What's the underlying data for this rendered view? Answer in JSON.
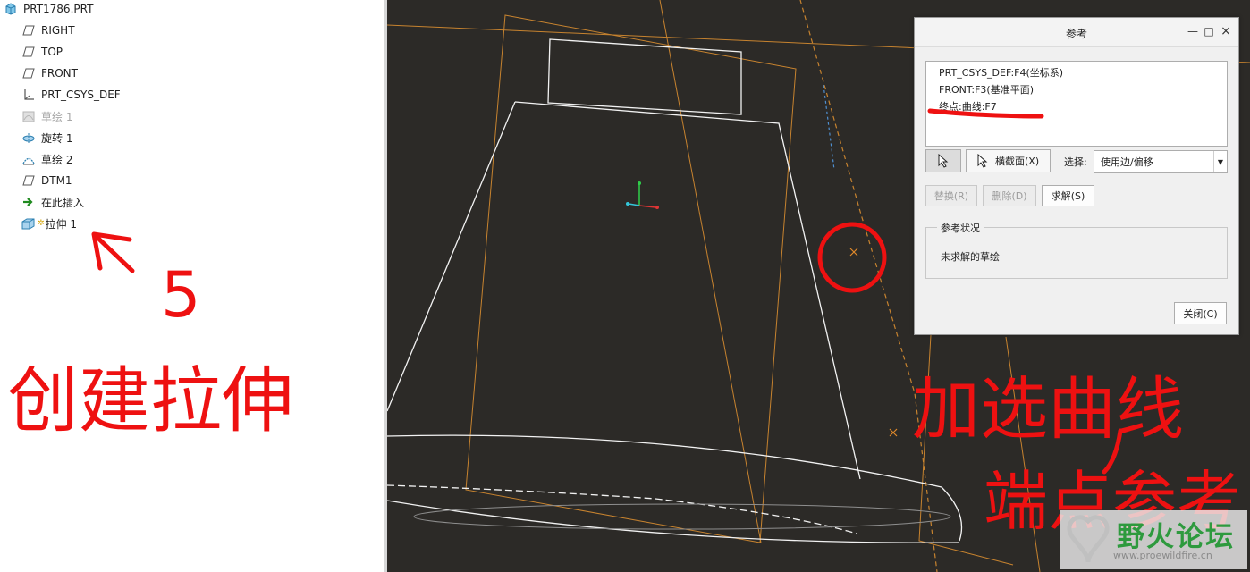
{
  "model_tree": {
    "root": "PRT1786.PRT",
    "items": [
      {
        "label": "RIGHT",
        "icon": "datum-plane-icon",
        "disabled": false
      },
      {
        "label": "TOP",
        "icon": "datum-plane-icon",
        "disabled": false
      },
      {
        "label": "FRONT",
        "icon": "datum-plane-icon",
        "disabled": false
      },
      {
        "label": "PRT_CSYS_DEF",
        "icon": "csys-icon",
        "disabled": false
      },
      {
        "label": "草绘 1",
        "icon": "sketch-icon",
        "disabled": true
      },
      {
        "label": "旋转 1",
        "icon": "revolve-icon",
        "disabled": false
      },
      {
        "label": "草绘 2",
        "icon": "sketch-icon",
        "disabled": false
      },
      {
        "label": "DTM1",
        "icon": "datum-plane-icon",
        "disabled": false
      },
      {
        "label": "在此插入",
        "icon": "insert-here-arrow-icon",
        "disabled": false
      },
      {
        "label": "拉伸 1",
        "icon": "extrude-icon",
        "disabled": false
      }
    ]
  },
  "dialog": {
    "title": "参考",
    "window_buttons": {
      "minimize": "—",
      "maximize": "□",
      "close": "×"
    },
    "references": [
      "PRT_CSYS_DEF:F4(坐标系)",
      "FRONT:F3(基准平面)",
      "终点:曲线:F7"
    ],
    "cross_section_button": "横截面(X)",
    "select_label": "选择:",
    "select_value": "使用边/偏移",
    "replace_button": "替换(R)",
    "delete_button": "删除(D)",
    "solve_button": "求解(S)",
    "status_group_title": "参考状况",
    "status_text": "未求解的草绘",
    "close_button": "关闭(C)"
  },
  "annotations": {
    "step_number": "5",
    "left_note": "创建拉伸",
    "right_note_line1": "加选曲线",
    "right_note_line2": "端点参考",
    "color": "#ee1111"
  },
  "watermark": {
    "brand": "野火论坛",
    "url": "www.proewildfire.cn"
  },
  "colors": {
    "viewport_bg": "#2c2a27",
    "datum_orange": "#c7832f",
    "geometry_white": "#f2f2f2"
  }
}
